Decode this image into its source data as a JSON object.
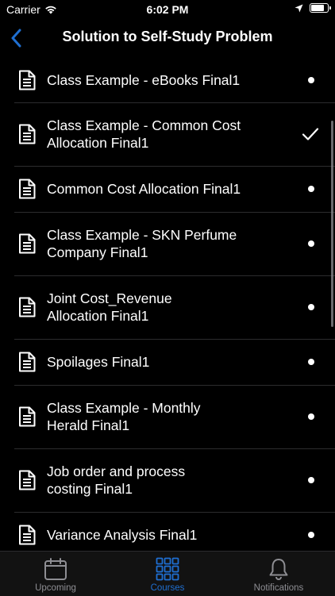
{
  "status_bar": {
    "carrier": "Carrier",
    "time": "6:02 PM",
    "battery_level": 0.9
  },
  "nav": {
    "back_icon": "chevron-left-icon",
    "title": "Solution to Self-Study Problem"
  },
  "colors": {
    "accent": "#1f6fd1",
    "background": "#000000",
    "separator": "#2c2c2e",
    "tab_inactive": "#8e8e93"
  },
  "list": {
    "items": [
      {
        "label": "Class Example - eBooks Final1",
        "status": "unread",
        "icon": "document-icon"
      },
      {
        "label": "Class Example - Common Cost\nAllocation Final1",
        "status": "completed",
        "icon": "document-icon"
      },
      {
        "label": "Common Cost Allocation Final1",
        "status": "unread",
        "icon": "document-icon"
      },
      {
        "label": "Class Example - SKN Perfume\nCompany Final1",
        "status": "unread",
        "icon": "document-icon"
      },
      {
        "label": "Joint Cost_Revenue\nAllocation Final1",
        "status": "unread",
        "icon": "document-icon"
      },
      {
        "label": "Spoilages Final1",
        "status": "unread",
        "icon": "document-icon"
      },
      {
        "label": "Class Example - Monthly\nHerald Final1",
        "status": "unread",
        "icon": "document-icon"
      },
      {
        "label": "Job order and process\ncosting Final1",
        "status": "unread",
        "icon": "document-icon"
      },
      {
        "label": "Variance Analysis Final1",
        "status": "unread",
        "icon": "document-icon"
      }
    ]
  },
  "tabs": [
    {
      "label": "Upcoming",
      "icon": "calendar-icon",
      "active": false
    },
    {
      "label": "Courses",
      "icon": "grid-icon",
      "active": true
    },
    {
      "label": "Notifications",
      "icon": "bell-icon",
      "active": false
    }
  ]
}
